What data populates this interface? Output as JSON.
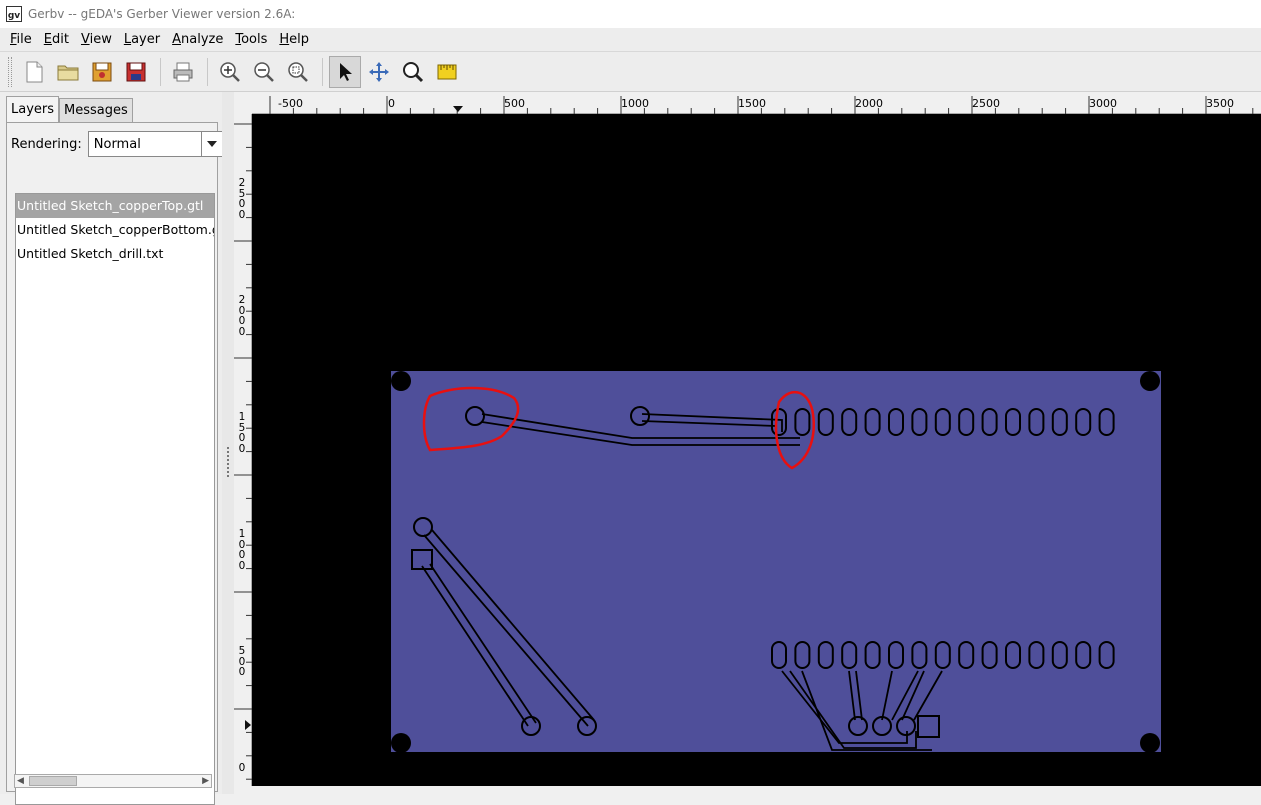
{
  "window": {
    "title": "Gerbv -- gEDA's Gerber Viewer version 2.6A:"
  },
  "menu": [
    {
      "key": "F",
      "rest": "ile"
    },
    {
      "key": "E",
      "rest": "dit"
    },
    {
      "key": "V",
      "rest": "iew"
    },
    {
      "key": "L",
      "rest": "ayer"
    },
    {
      "key": "A",
      "rest": "nalyze"
    },
    {
      "key": "T",
      "rest": "ools"
    },
    {
      "key": "H",
      "rest": "elp"
    }
  ],
  "toolbar": {
    "icons": [
      "new-file-icon",
      "open-folder-icon",
      "revert-icon",
      "save-icon",
      "print-icon",
      "zoom-in-icon",
      "zoom-out-icon",
      "zoom-fit-icon",
      "pointer-icon",
      "pan-icon",
      "zoom-tool-icon",
      "measure-icon"
    ],
    "active": "pointer-icon"
  },
  "sidebar": {
    "tabs": [
      {
        "label": "Layers",
        "active": true
      },
      {
        "label": "Messages",
        "active": false
      }
    ],
    "rendering_label": "Rendering:",
    "rendering_value": "Normal",
    "layers": [
      {
        "name": "Untitled Sketch_copperTop.gtl",
        "selected": true
      },
      {
        "name": "Untitled Sketch_copperBottom.gbl",
        "selected": false
      },
      {
        "name": "Untitled Sketch_drill.txt",
        "selected": false
      }
    ]
  },
  "ruler": {
    "horizontal": [
      "-500",
      "0",
      "500",
      "1000",
      "1500",
      "2000",
      "2500",
      "3000",
      "3500"
    ],
    "vertical": [
      "2500",
      "2000",
      "1500",
      "1000",
      "500",
      "0"
    ]
  },
  "colors": {
    "board": "#4f4f9a",
    "canvas": "#000000",
    "annotation": "#e81010"
  }
}
